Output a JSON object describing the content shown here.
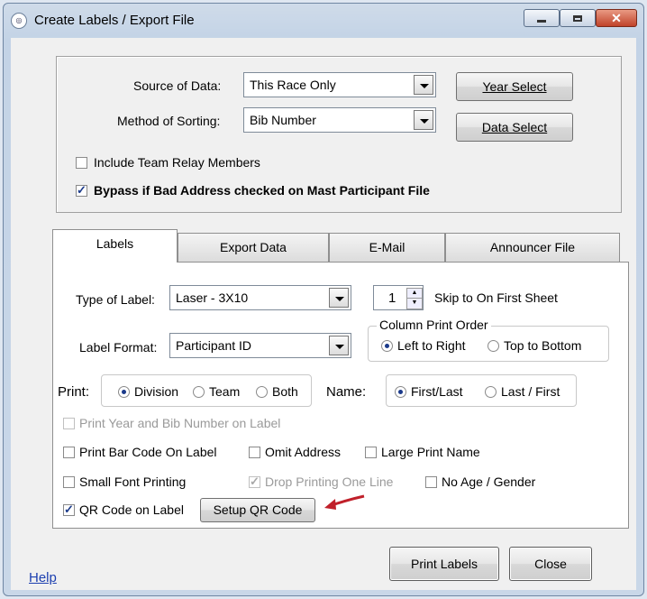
{
  "window": {
    "title": "Create Labels / Export File",
    "app_icon": "app-logo-icon"
  },
  "top_group": {
    "source_label": "Source of Data:",
    "source_value": "This Race Only",
    "sorting_label": "Method of Sorting:",
    "sorting_value": "Bib Number",
    "year_select": "Year Select",
    "data_select": "Data Select",
    "include_team": {
      "label": "Include Team Relay Members",
      "checked": false
    },
    "bypass": {
      "label": "Bypass if Bad Address checked on Mast Participant File",
      "checked": true
    }
  },
  "tabs": [
    {
      "label": "Labels",
      "active": true
    },
    {
      "label": "Export Data",
      "active": false
    },
    {
      "label": "E-Mail",
      "active": false
    },
    {
      "label": "Announcer File",
      "active": false
    }
  ],
  "labels_tab": {
    "type_label": "Type of Label:",
    "type_value": "Laser - 3X10",
    "skip_value": "1",
    "skip_label": "Skip to On First Sheet",
    "format_label": "Label Format:",
    "format_value": "Participant ID",
    "column_order_title": "Column Print Order",
    "left_to_right": "Left to Right",
    "top_to_bottom": "Top to Bottom",
    "print_label": "Print:",
    "division": "Division",
    "team": "Team",
    "both": "Both",
    "name_label": "Name:",
    "first_last": "First/Last",
    "last_first": "Last / First",
    "print_year_bib": "Print Year and Bib Number on Label",
    "print_bar_code": "Print Bar Code On Label",
    "omit_address": "Omit Address",
    "large_print": "Large Print Name",
    "small_font": "Small Font Printing",
    "drop_printing": "Drop Printing One Line",
    "no_age_gender": "No Age / Gender",
    "qr_code": "QR Code on Label",
    "setup_qr": "Setup QR Code"
  },
  "footer": {
    "help": "Help",
    "print_labels": "Print Labels",
    "close": "Close"
  },
  "colors": {
    "arrow": "#c0202a",
    "link": "#1c3fb0",
    "accent": "#1b3a8a"
  }
}
